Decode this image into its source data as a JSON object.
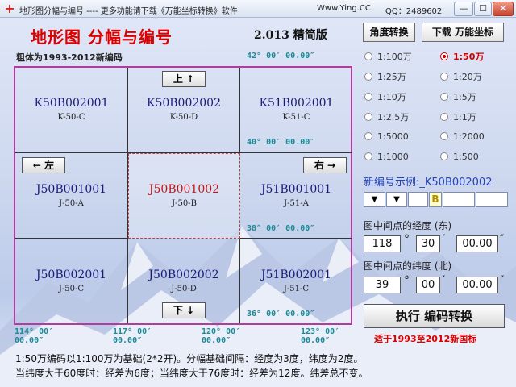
{
  "window": {
    "title": "地形图分幅与编号 ---- 更多功能请下载《万能坐标转换》软件",
    "url": "Www.Ying.CC",
    "qq": "QQ：2489602",
    "minimize": "—",
    "maximize": "☐",
    "close": "✕"
  },
  "header": {
    "title": "地形图 分幅与编号",
    "version": "2.013 精简版",
    "angle_button": "角度转换",
    "download_button": "下载 万能坐标",
    "subtitle": "粗体为1993-2012新编码"
  },
  "latitudes": [
    "42° 00′ 00.00″",
    "40° 00′ 00.00″",
    "38° 00′ 00.00″",
    "36° 00′ 00.00″"
  ],
  "longitudes": [
    {
      "deg": "114° 00′",
      "sec": "00.00″"
    },
    {
      "deg": "117° 00′",
      "sec": "00.00″"
    },
    {
      "deg": "120° 00′",
      "sec": "00.00″"
    },
    {
      "deg": "123° 00′",
      "sec": "00.00″"
    }
  ],
  "grid": [
    {
      "code": "K50B002001",
      "old": "K-50-C"
    },
    {
      "code": "K50B002002",
      "old": "K-50-D"
    },
    {
      "code": "K51B002001",
      "old": "K-51-C"
    },
    {
      "code": "J50B001001",
      "old": "J-50-A"
    },
    {
      "code": "J50B001002",
      "old": "J-50-B"
    },
    {
      "code": "J51B001001",
      "old": "J-51-A"
    },
    {
      "code": "J50B002001",
      "old": "J-50-C"
    },
    {
      "code": "J50B002002",
      "old": "J-50-D"
    },
    {
      "code": "J51B002001",
      "old": "J-51-C"
    }
  ],
  "nav": {
    "up": "上 ↑",
    "down": "下 ↓",
    "left": "← 左",
    "right": "右 →"
  },
  "scales": [
    {
      "label": "1:100万",
      "selected": false
    },
    {
      "label": "1:50万",
      "selected": true
    },
    {
      "label": "1:25万",
      "selected": false
    },
    {
      "label": "1:20万",
      "selected": false
    },
    {
      "label": "1:10万",
      "selected": false
    },
    {
      "label": "1:5万",
      "selected": false
    },
    {
      "label": "1:2.5万",
      "selected": false
    },
    {
      "label": "1:1万",
      "selected": false
    },
    {
      "label": "1:5000",
      "selected": false
    },
    {
      "label": "1:2000",
      "selected": false
    },
    {
      "label": "1:1000",
      "selected": false
    },
    {
      "label": "1:500",
      "selected": false
    }
  ],
  "example": "新编号示例:_K50B002002",
  "code_selectors": [
    "▼",
    "▼",
    "",
    "B",
    "",
    ""
  ],
  "longitude": {
    "label": "图中间点的经度 (东)",
    "deg": "118",
    "min": "30",
    "sec": "00.00"
  },
  "latitude": {
    "label": "图中间点的纬度 (北)",
    "deg": "39",
    "min": "00",
    "sec": "00.00"
  },
  "units": {
    "deg": "°",
    "min": "′",
    "sec": "″"
  },
  "execute_button": "执行  编码转换",
  "standard_note": "适于1993至2012新国标",
  "footer": {
    "line1": "1:50万编码以1:100万为基础(2*2开)。分幅基础间隔：经度为3度，纬度为2度。",
    "line2": "当纬度大于60度时：经差为6度；当纬度大于76度时：经差为12度。纬差总不变。"
  },
  "colors": {
    "accent": "#dd0000",
    "grid_border": "#b03c9e",
    "coord_text": "#1a8a96",
    "code_text": "#1b1b7a"
  }
}
